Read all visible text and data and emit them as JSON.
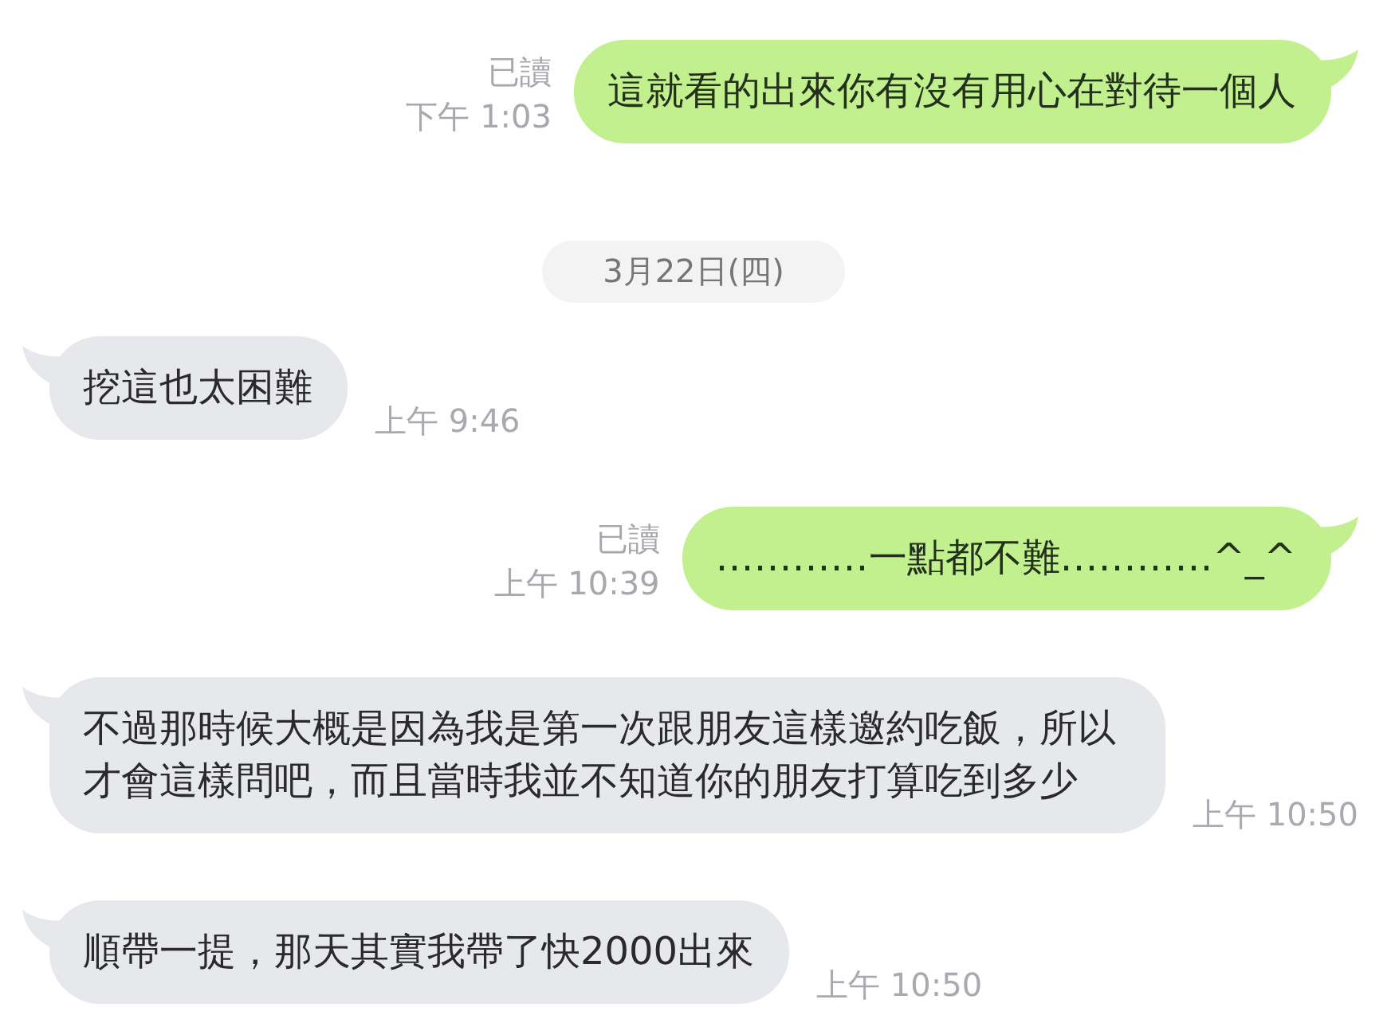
{
  "messages": [
    {
      "kind": "sent",
      "text": "這就看的出來你有沒有用心在對待一個人",
      "read_label": "已讀",
      "time": "下午 1:03"
    },
    {
      "kind": "date",
      "text": "3月22日(四)"
    },
    {
      "kind": "received",
      "text": "挖這也太困難",
      "time": "上午 9:46"
    },
    {
      "kind": "sent",
      "text": "…………一點都不難…………^_^",
      "read_label": "已讀",
      "time": "上午 10:39"
    },
    {
      "kind": "received",
      "text": "不過那時候大概是因為我是第一次跟朋友這樣邀約吃飯，所以才會這樣問吧，而且當時我並不知道你的朋友打算吃到多少",
      "time": "上午 10:50"
    },
    {
      "kind": "received",
      "text": "順帶一提，那天其實我帶了快2000出來",
      "time": "上午 10:50"
    }
  ]
}
